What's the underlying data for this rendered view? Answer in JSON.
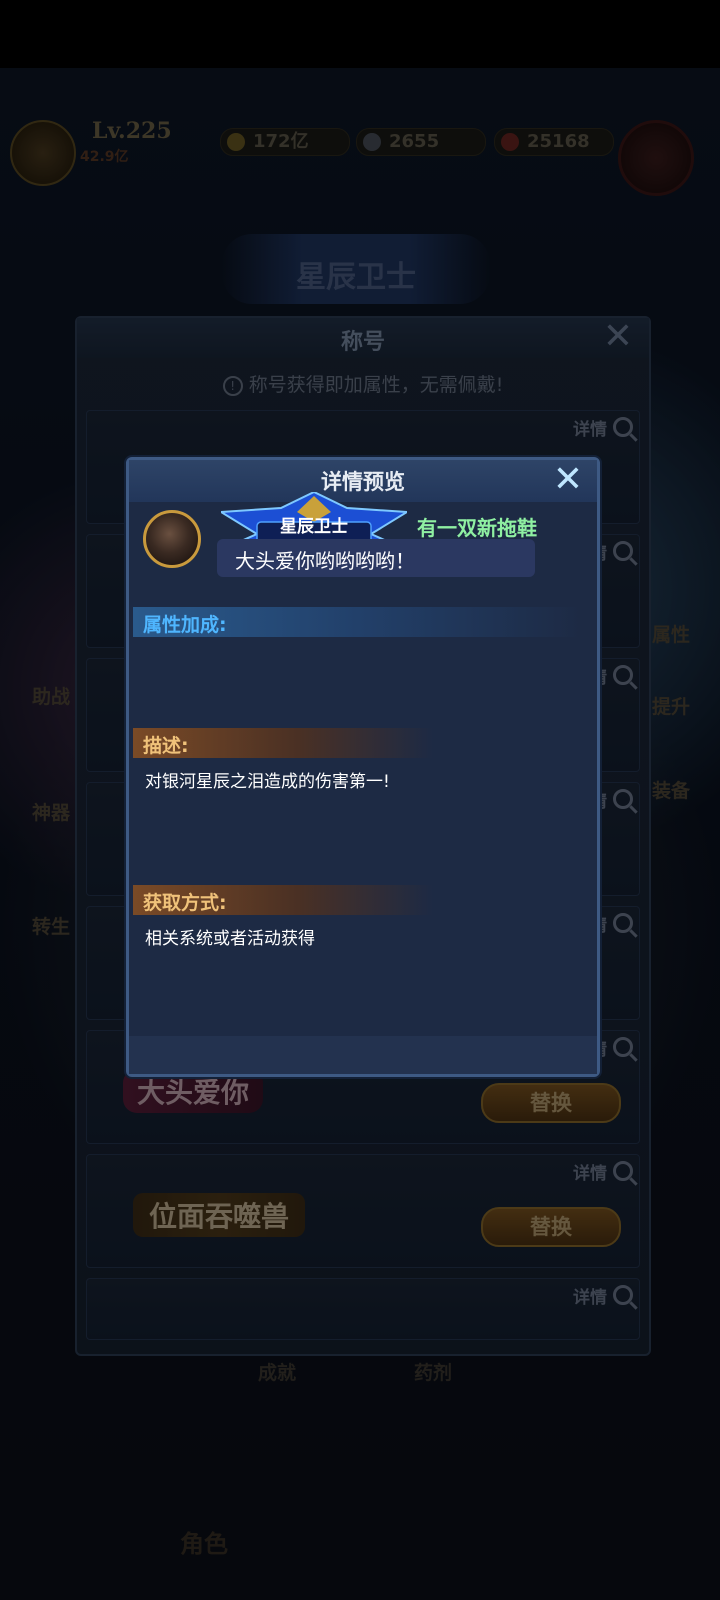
{
  "hud": {
    "level": "Lv.225",
    "power": "42.9亿",
    "gold": "172亿",
    "diamonds": "2655",
    "gems": "25168"
  },
  "banner": {
    "title": "星辰卫士"
  },
  "side_left": [
    "助战",
    "神器",
    "转生"
  ],
  "side_right": [
    "属性",
    "提升",
    "装备"
  ],
  "list_panel": {
    "title": "称号",
    "notice": "称号获得即加属性，无需佩戴!",
    "detail_label": "详情",
    "replace_label": "替换",
    "badges": [
      "大头爱你",
      "位面吞噬兽"
    ]
  },
  "bottom_tabs": [
    "成就",
    "药剂"
  ],
  "bottom_nav": [
    "角色"
  ],
  "modal": {
    "title": "详情预览",
    "emblem_text": "星辰卫士",
    "player_name": "有一双新拖鞋",
    "signature": "大头爱你哟哟哟哟！",
    "attr_heading": "属性加成:",
    "desc_heading": "描述:",
    "desc_text": "对银河星辰之泪造成的伤害第一!",
    "obtain_heading": "获取方式:",
    "obtain_text": "相关系统或者活动获得"
  },
  "colors": {
    "attr_heading": "#4fb6ff",
    "desc_heading": "#f0c27a",
    "player_name": "#8ff0a2",
    "close_icon": "#bfe6ff"
  }
}
